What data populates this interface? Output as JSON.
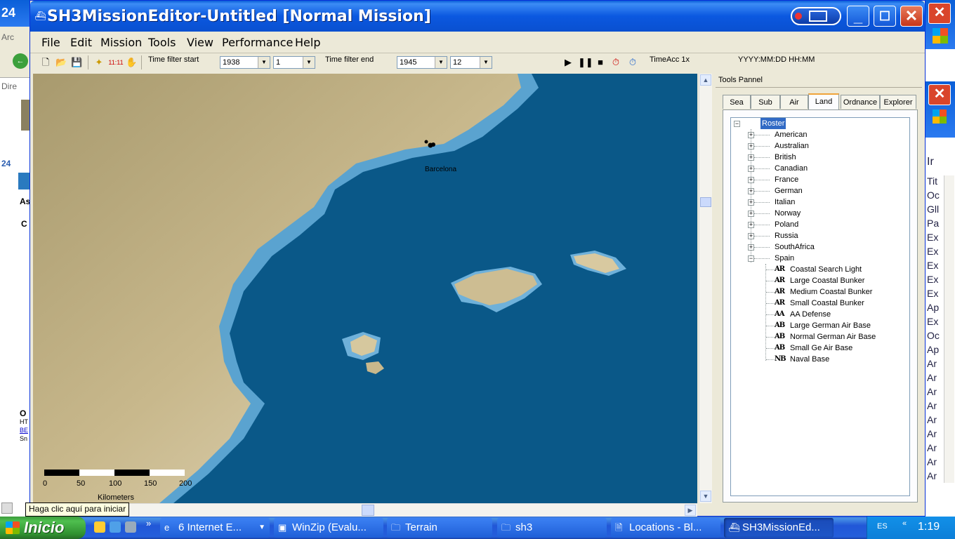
{
  "window": {
    "title": "SH3MissionEditor-Untitled [Normal Mission]"
  },
  "menu": [
    "File",
    "Edit",
    "Mission",
    "Tools",
    "View",
    "Performance",
    "Help"
  ],
  "toolbar": {
    "time_icon_text": "11:11",
    "filter_start_label": "Time filter start",
    "filter_start_year": "1938",
    "filter_start_month": "1",
    "filter_end_label": "Time filter end",
    "filter_end_year": "1945",
    "filter_end_month": "12",
    "time_acc": "TimeAcc 1x",
    "datetime_format": "YYYY:MM:DD HH:MM"
  },
  "map": {
    "city_label": "Barcelona",
    "scale_ticks": [
      "0",
      "50",
      "100",
      "150",
      "200"
    ],
    "scale_unit": "Kilometers"
  },
  "tooltip": "Haga clic aquí para iniciar",
  "tools_panel": {
    "title": "Tools Pannel",
    "tabs": [
      "Sea",
      "Sub",
      "Air",
      "Land",
      "Ordnance",
      "Explorer"
    ],
    "active_tab": "Land",
    "tree_root": "Roster",
    "countries": [
      "American",
      "Australian",
      "British",
      "Canadian",
      "France",
      "German",
      "Italian",
      "Norway",
      "Poland",
      "Russia",
      "SouthAfrica",
      "Spain"
    ],
    "spain_units": [
      {
        "icon": "AR",
        "label": "Coastal Search Light"
      },
      {
        "icon": "AR",
        "label": "Large Coastal Bunker"
      },
      {
        "icon": "AR",
        "label": "Medium Coastal Bunker"
      },
      {
        "icon": "AR",
        "label": "Small Coastal Bunker"
      },
      {
        "icon": "AA",
        "label": "AA Defense"
      },
      {
        "icon": "AB",
        "label": "Large German Air Base"
      },
      {
        "icon": "AB",
        "label": "Normal German Air Base"
      },
      {
        "icon": "AB",
        "label": "Small Ge Air Base"
      },
      {
        "icon": "NB",
        "label": "Naval Base"
      }
    ]
  },
  "background_windows": {
    "left_text": [
      "24",
      "Arc",
      "Dire",
      "24",
      "As",
      "C",
      "O",
      "HT",
      "BE",
      "Sn"
    ],
    "right_text": [
      "Ir",
      "Tit",
      "Oc",
      "Gll",
      "Pa",
      "Ex",
      "Ex",
      "Ex",
      "Ex",
      "Ex",
      "Ap",
      "Ex",
      "Oc",
      "Ap",
      "Ar",
      "Ar",
      "Ar",
      "Ar",
      "Ar",
      "Ar",
      "Ar",
      "Ar",
      "Ar"
    ]
  },
  "taskbar": {
    "start_label": "Inicio",
    "quicklaunch_more": "»",
    "tasks": [
      {
        "label": "6 Internet E..."
      },
      {
        "label": "WinZip (Evalu..."
      },
      {
        "label": "Terrain"
      },
      {
        "label": "sh3"
      },
      {
        "label": "Locations - Bl..."
      },
      {
        "label": "SH3MissionEd..."
      }
    ],
    "language": "ES",
    "clock": "1:19"
  },
  "colors": {
    "sea_deep": "#0a5888",
    "sea_shallow": "#5aa3d0",
    "land": "#c8b78c",
    "titlebar": "#0a5fd8"
  }
}
